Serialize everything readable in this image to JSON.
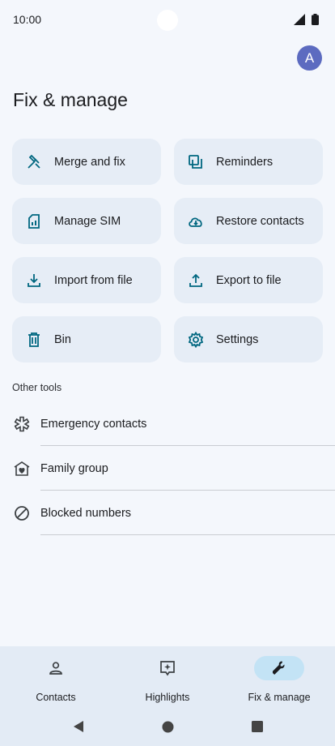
{
  "status": {
    "time": "10:00"
  },
  "avatar": {
    "initial": "A"
  },
  "page": {
    "title": "Fix & manage"
  },
  "tiles": [
    {
      "label": "Merge and fix",
      "icon": "merge-fix-icon"
    },
    {
      "label": "Reminders",
      "icon": "reminders-icon"
    },
    {
      "label": "Manage SIM",
      "icon": "sim-card-icon"
    },
    {
      "label": "Restore contacts",
      "icon": "cloud-download-icon"
    },
    {
      "label": "Import from file",
      "icon": "download-icon"
    },
    {
      "label": "Export to file",
      "icon": "upload-icon"
    },
    {
      "label": "Bin",
      "icon": "trash-icon"
    },
    {
      "label": "Settings",
      "icon": "gear-icon"
    }
  ],
  "other_tools": {
    "heading": "Other tools",
    "items": [
      {
        "label": "Emergency contacts",
        "icon": "emergency-icon"
      },
      {
        "label": "Family group",
        "icon": "family-home-icon"
      },
      {
        "label": "Blocked numbers",
        "icon": "block-icon"
      }
    ]
  },
  "bottom_nav": {
    "items": [
      {
        "label": "Contacts",
        "icon": "person-icon",
        "active": false
      },
      {
        "label": "Highlights",
        "icon": "highlights-icon",
        "active": false
      },
      {
        "label": "Fix & manage",
        "icon": "wrench-icon",
        "active": true
      }
    ]
  },
  "colors": {
    "accent": "#006780",
    "tile_bg": "#e6edf6",
    "nav_active": "#c3e3f5",
    "avatar": "#5c6bc0"
  }
}
